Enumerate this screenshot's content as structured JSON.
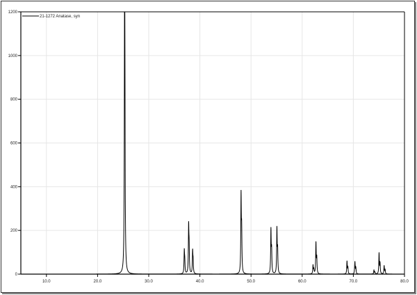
{
  "chart_data": {
    "type": "line",
    "title": "",
    "xlabel": "",
    "ylabel": "",
    "xlim": [
      5,
      80
    ],
    "ylim": [
      0,
      1200
    ],
    "grid": true,
    "x_ticks": [
      "10.0",
      "20.0",
      "30.0",
      "40.0",
      "50.0",
      "60.0",
      "70.0",
      "80.0"
    ],
    "y_ticks": [
      "0",
      "200",
      "400",
      "600",
      "800",
      "1000",
      "1200"
    ],
    "legend": {
      "placement": "top-left",
      "entries": [
        "21-1272 Anatase, syn"
      ]
    },
    "series": [
      {
        "name": "21-1272 Anatase, syn",
        "color": "#000000",
        "peaks": [
          {
            "two_theta": 25.28,
            "intensity": 1120
          },
          {
            "two_theta": 36.95,
            "intensity": 100
          },
          {
            "two_theta": 37.8,
            "intensity": 210
          },
          {
            "two_theta": 38.58,
            "intensity": 100
          },
          {
            "two_theta": 48.05,
            "intensity": 350
          },
          {
            "two_theta": 53.89,
            "intensity": 198
          },
          {
            "two_theta": 55.06,
            "intensity": 203
          },
          {
            "two_theta": 62.12,
            "intensity": 40
          },
          {
            "two_theta": 62.69,
            "intensity": 140
          },
          {
            "two_theta": 68.76,
            "intensity": 58
          },
          {
            "two_theta": 70.31,
            "intensity": 56
          },
          {
            "two_theta": 74.03,
            "intensity": 18
          },
          {
            "two_theta": 75.03,
            "intensity": 95
          },
          {
            "two_theta": 76.02,
            "intensity": 38
          }
        ]
      }
    ]
  }
}
